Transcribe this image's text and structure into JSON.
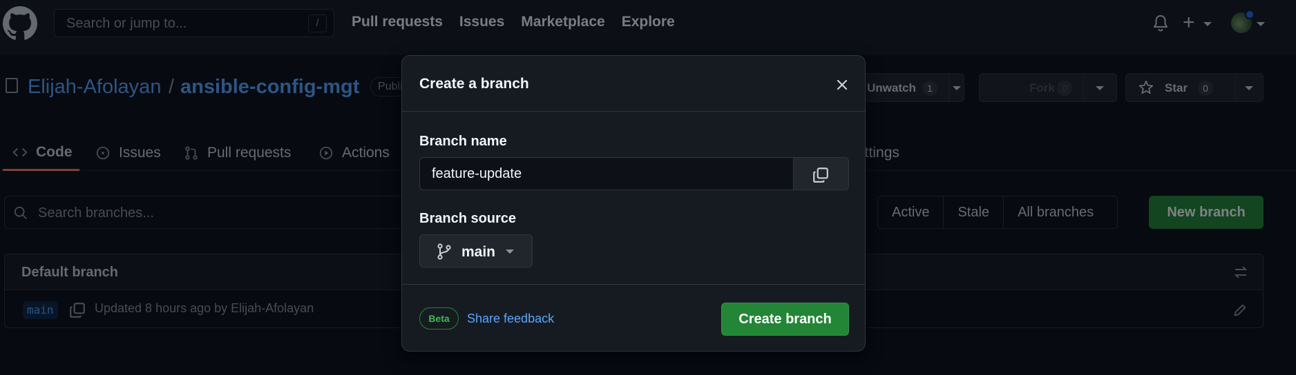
{
  "header": {
    "search_placeholder": "Search or jump to...",
    "search_shortcut": "/",
    "nav": [
      "Pull requests",
      "Issues",
      "Marketplace",
      "Explore"
    ],
    "plus_label": "+"
  },
  "repo": {
    "owner": "Elijah-Afolayan",
    "separator": "/",
    "name": "ansible-config-mgt",
    "visibility": "Public",
    "watch_label": "Unwatch",
    "watch_count": "1",
    "fork_label": "Fork",
    "fork_count": "0",
    "star_label": "Star",
    "star_count": "0"
  },
  "tabs": [
    {
      "label": "Code",
      "icon": "code-icon",
      "active": true
    },
    {
      "label": "Issues",
      "icon": "issue-icon"
    },
    {
      "label": "Pull requests",
      "icon": "pull-request-icon"
    },
    {
      "label": "Actions",
      "icon": "play-icon"
    },
    {
      "label": "Settings",
      "icon": "gear-icon"
    }
  ],
  "branches": {
    "search_placeholder": "Search branches...",
    "filters": [
      "Active",
      "Stale",
      "All branches"
    ],
    "new_branch": "New branch",
    "default_title": "Default branch",
    "default_name": "main",
    "updated_text": "Updated 8 hours ago by Elijah-Afolayan"
  },
  "dialog": {
    "title": "Create a branch",
    "name_label": "Branch name",
    "name_value": "feature-update",
    "source_label": "Branch source",
    "source_value": "main",
    "beta_label": "Beta",
    "feedback_link": "Share feedback",
    "create_button": "Create branch"
  },
  "colors": {
    "background": "#0d1117",
    "header": "#161b22",
    "link": "#58a6ff",
    "primary_button": "#238636",
    "border": "#30363d"
  }
}
